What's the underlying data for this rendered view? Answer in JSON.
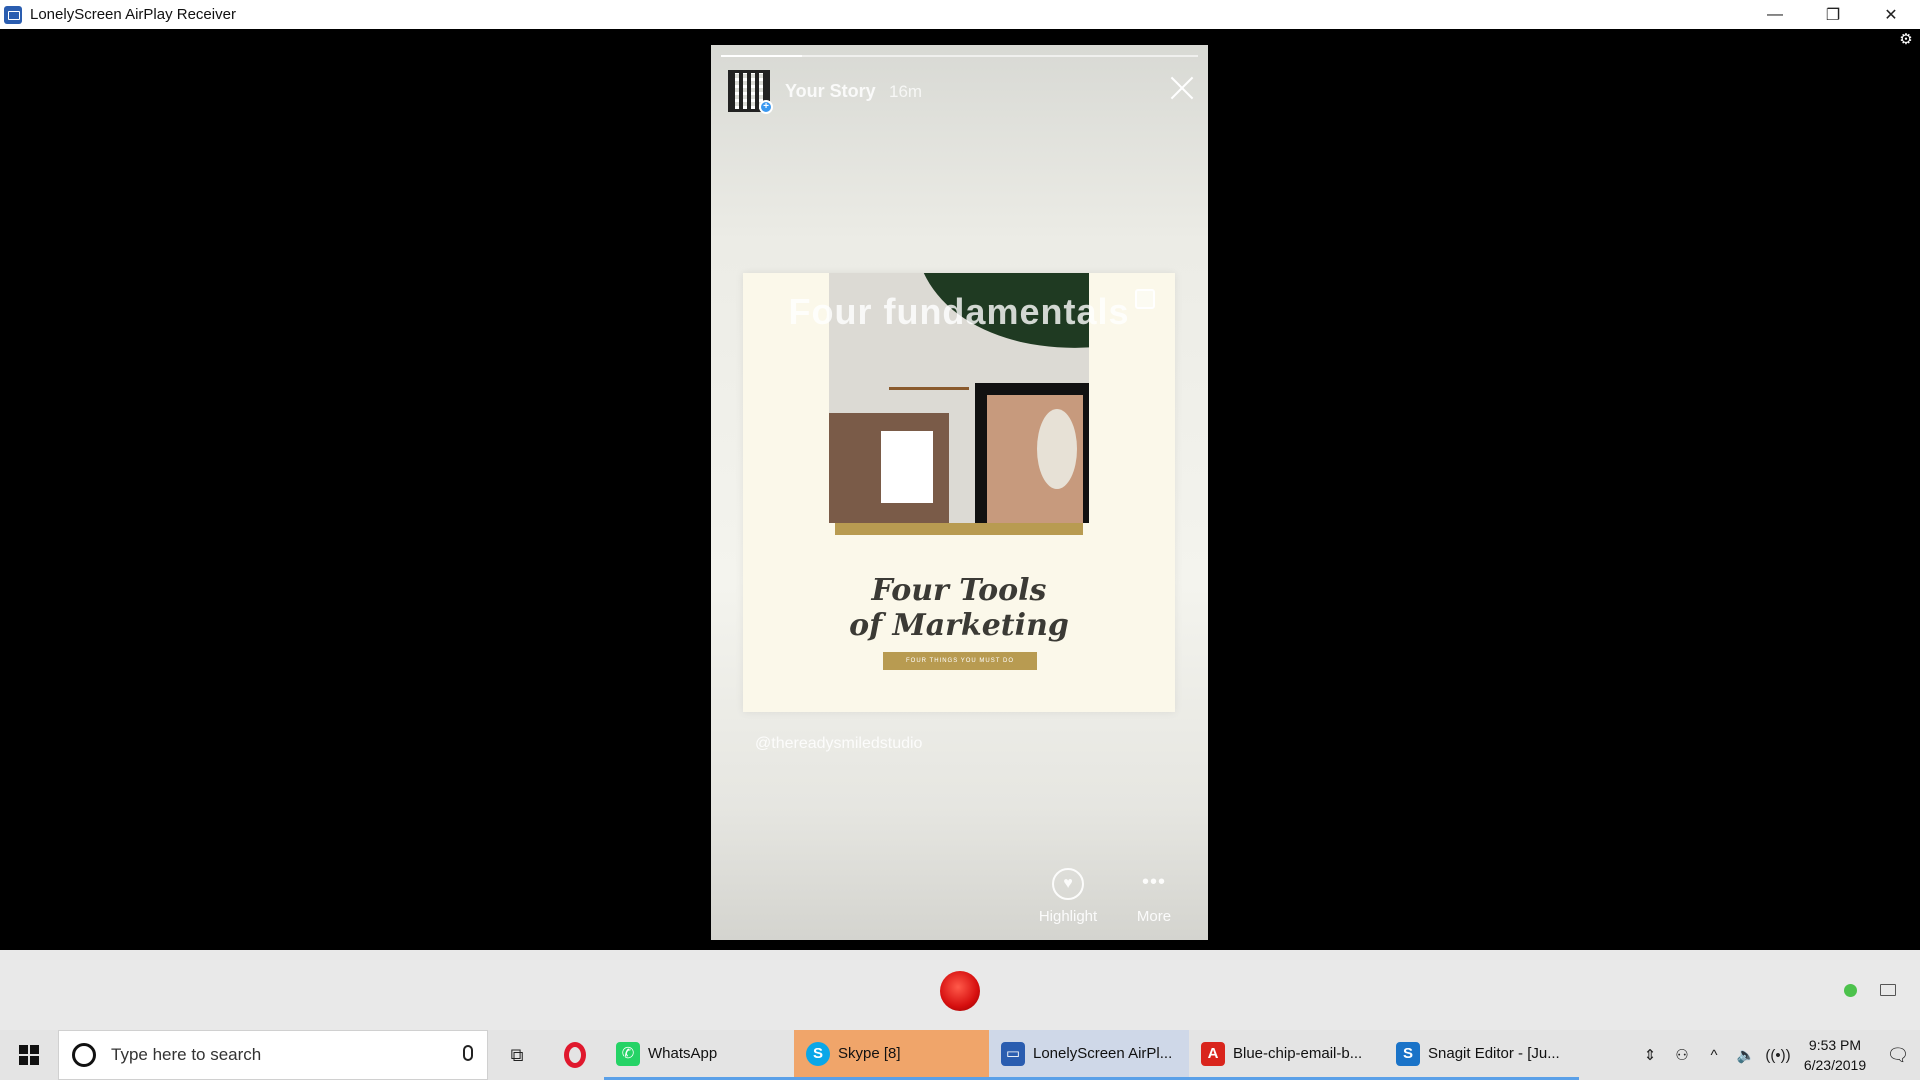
{
  "window": {
    "title": "LonelyScreen AirPlay Receiver",
    "minimize": "—",
    "restore": "❐",
    "close": "✕",
    "gear": "⚙"
  },
  "story": {
    "name": "Your Story",
    "time": "16m",
    "progress_fraction": 0.17,
    "overlay_title": "Four fundamentals",
    "main_title_line1": "Four Tools",
    "main_title_line2": "of Marketing",
    "badge": "FOUR THINGS YOU MUST DO",
    "handle": "@thereadysmiledstudio",
    "highlight_icon": "♥",
    "highlight_label": "Highlight",
    "more_icon": "•••",
    "more_label": "More"
  },
  "receiver": {
    "chevron": "⌄"
  },
  "taskbar": {
    "search_placeholder": "Type here to search",
    "task_view_icon": "⧉",
    "tasks": [
      {
        "label": "WhatsApp",
        "icon": "✆",
        "color": "#25d366"
      },
      {
        "label": "Skype [8]",
        "icon": "S",
        "color": "#0aa7e8"
      },
      {
        "label": "LonelyScreen AirPl...",
        "icon": "▭",
        "color": "#2a5db0"
      },
      {
        "label": "Blue-chip-email-b...",
        "icon": "A",
        "color": "#d9251d"
      },
      {
        "label": "Snagit Editor - [Ju...",
        "icon": "S",
        "color": "#1a73c8"
      }
    ],
    "time": "9:53 PM",
    "date": "6/23/2019",
    "tray_icons": {
      "scroll": "⇕",
      "people": "⚇",
      "chevron_up": "^",
      "volume": "🔈",
      "wifi": "((•))",
      "notification": "🗨"
    }
  }
}
